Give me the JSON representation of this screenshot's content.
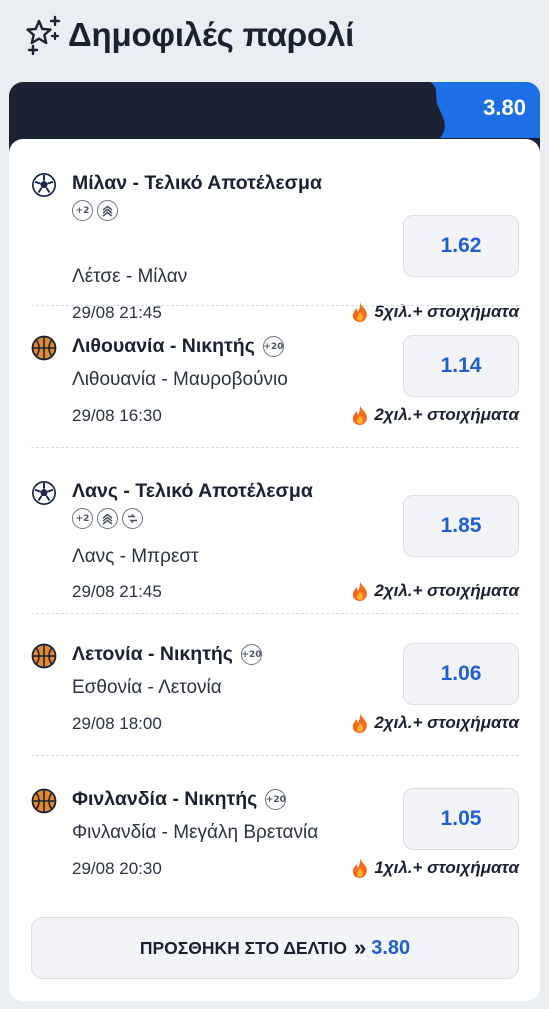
{
  "header": {
    "title": "Δημοφιλές παρολί",
    "icon": "sparkle-star-icon"
  },
  "total_odds": "3.80",
  "legs": [
    {
      "sport": "soccer",
      "sport_icon": "soccer-ball-icon",
      "market": "Μίλαν - Τελικό Αποτέλεσμα",
      "badges": [
        "+2",
        "boost"
      ],
      "badges_below": true,
      "match": "Λέτσε - Μίλαν",
      "datetime": "29/08 21:45",
      "popularity": "5χιλ.+ στοιχήματα",
      "odds": "1.62"
    },
    {
      "sport": "basketball",
      "sport_icon": "basketball-icon",
      "market": "Λιθουανία - Νικητής",
      "badges": [
        "+20"
      ],
      "badges_below": false,
      "match": "Λιθουανία - Μαυροβούνιο",
      "datetime": "29/08 16:30",
      "popularity": "2χιλ.+ στοιχήματα",
      "odds": "1.14"
    },
    {
      "sport": "soccer",
      "sport_icon": "soccer-ball-icon",
      "market": "Λανς - Τελικό Αποτέλεσμα",
      "badges": [
        "+2",
        "boost",
        "cashout"
      ],
      "badges_below": true,
      "match": "Λανς - Μπρεστ",
      "datetime": "29/08 21:45",
      "popularity": "2χιλ.+ στοιχήματα",
      "odds": "1.85"
    },
    {
      "sport": "basketball",
      "sport_icon": "basketball-icon",
      "market": "Λετονία - Νικητής",
      "badges": [
        "+20"
      ],
      "badges_below": false,
      "match": "Εσθονία - Λετονία",
      "datetime": "29/08 18:00",
      "popularity": "2χιλ.+ στοιχήματα",
      "odds": "1.06"
    },
    {
      "sport": "basketball",
      "sport_icon": "basketball-icon",
      "market": "Φινλανδία - Νικητής",
      "badges": [
        "+20"
      ],
      "badges_below": false,
      "match": "Φινλανδία - Μεγάλη Βρετανία",
      "datetime": "29/08 20:30",
      "popularity": "1χιλ.+ στοιχήματα",
      "odds": "1.05"
    }
  ],
  "add_button": {
    "label": "ΠΡΟΣΘΗΚΗ ΣΤΟ ΔΕΛΤΙΟ",
    "chevron": "»",
    "odds": "3.80"
  },
  "colors": {
    "accent": "#1f5fd1",
    "tab_blue": "#1d6fe6",
    "dark": "#1c2233",
    "fire": "#f26b1d",
    "basketball": "#e3892b"
  }
}
